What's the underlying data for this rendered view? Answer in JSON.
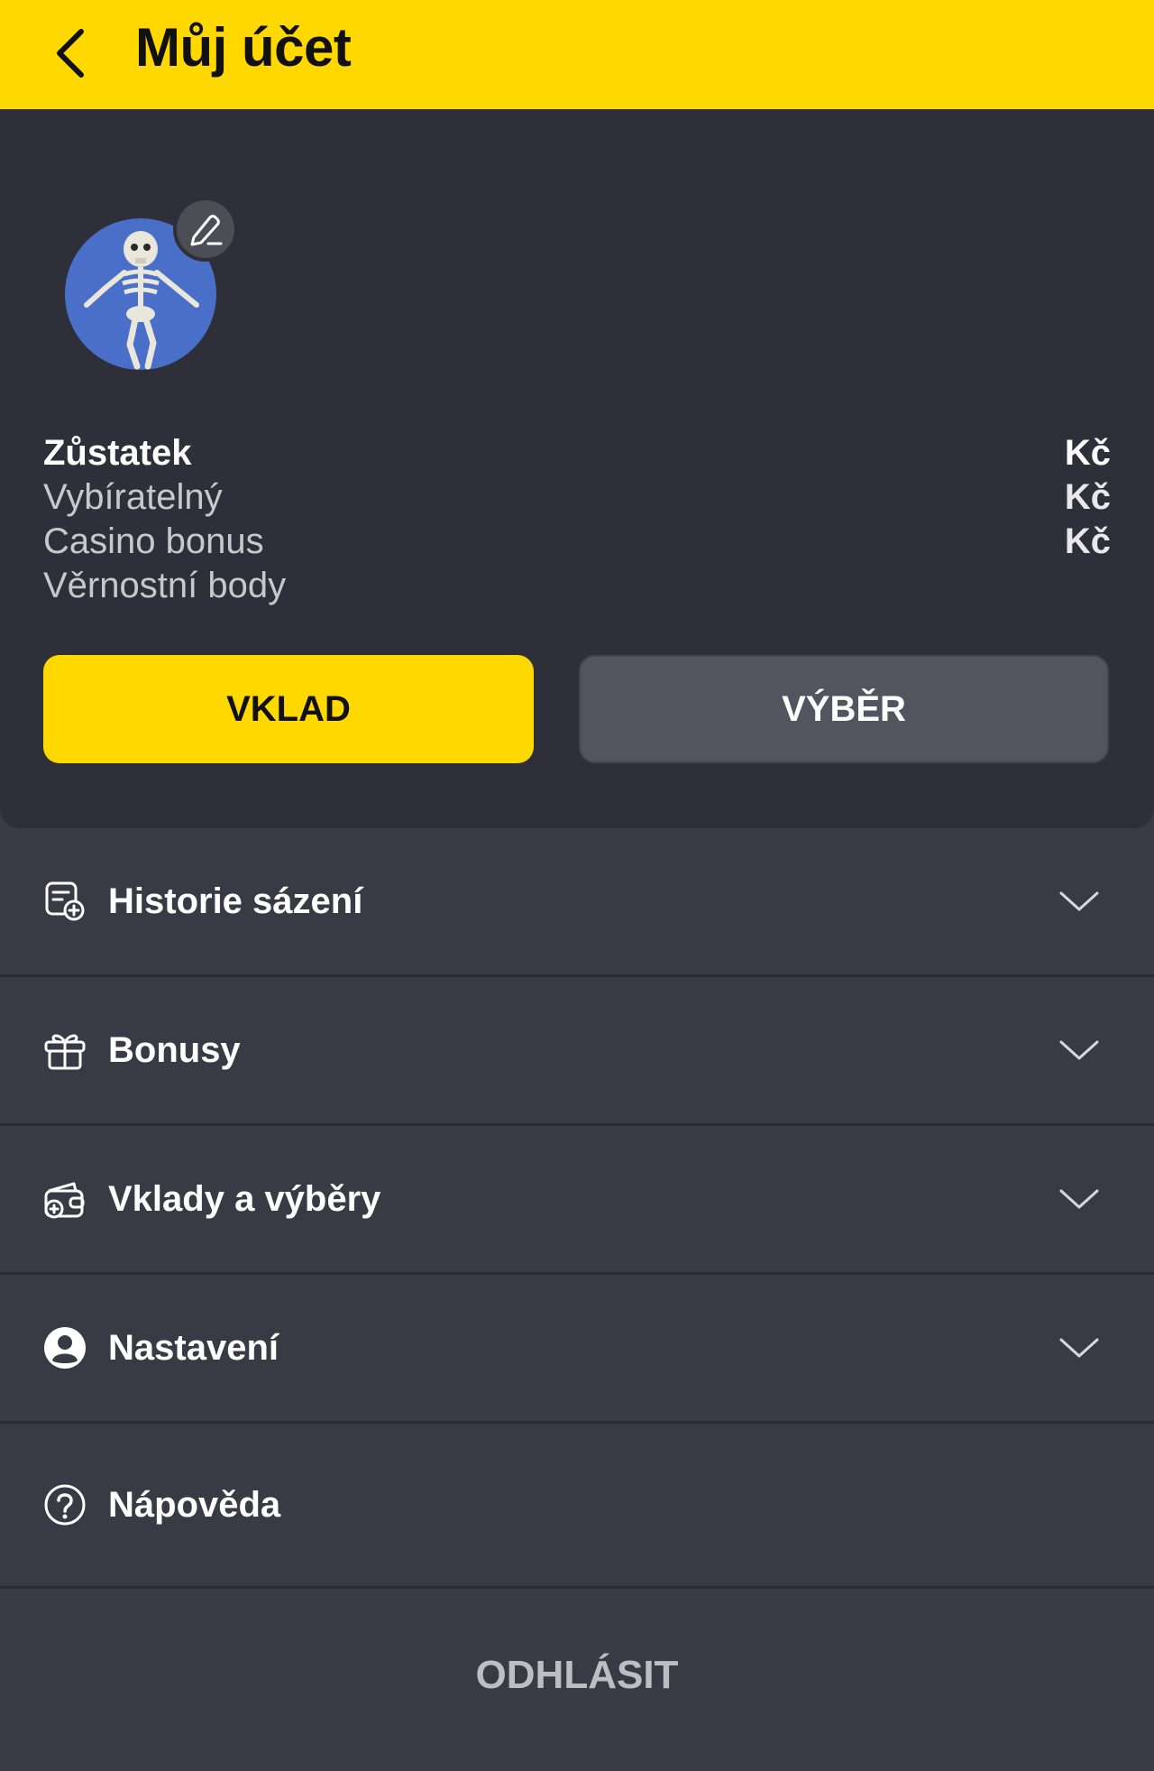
{
  "header": {
    "title": "Můj účet",
    "back_icon": "chevron-left-icon",
    "background": "#ffd800"
  },
  "account": {
    "avatar": "skeleton-avatar",
    "edit_icon": "pencil-icon",
    "balances": [
      {
        "label": "Zůstatek",
        "value": "Kč"
      },
      {
        "label": "Vybíratelný",
        "value": "Kč"
      },
      {
        "label": "Casino bonus",
        "value": "Kč"
      },
      {
        "label": "Věrnostní body",
        "value": ""
      }
    ],
    "deposit_label": "VKLAD",
    "withdraw_label": "VÝBĚR"
  },
  "menu": [
    {
      "label": "Historie sázení",
      "icon": "bet-history-icon",
      "expandable": true
    },
    {
      "label": "Bonusy",
      "icon": "gift-icon",
      "expandable": true
    },
    {
      "label": "Vklady a výběry",
      "icon": "wallet-icon",
      "expandable": true
    },
    {
      "label": "Nastavení",
      "icon": "user-icon",
      "expandable": true
    },
    {
      "label": "Nápověda",
      "icon": "help-icon",
      "expandable": false
    }
  ],
  "logout_label": "ODHLÁSIT",
  "colors": {
    "accent": "#ffd800",
    "card_bg": "#2f2f39",
    "menu_bg": "#3a3a44"
  }
}
